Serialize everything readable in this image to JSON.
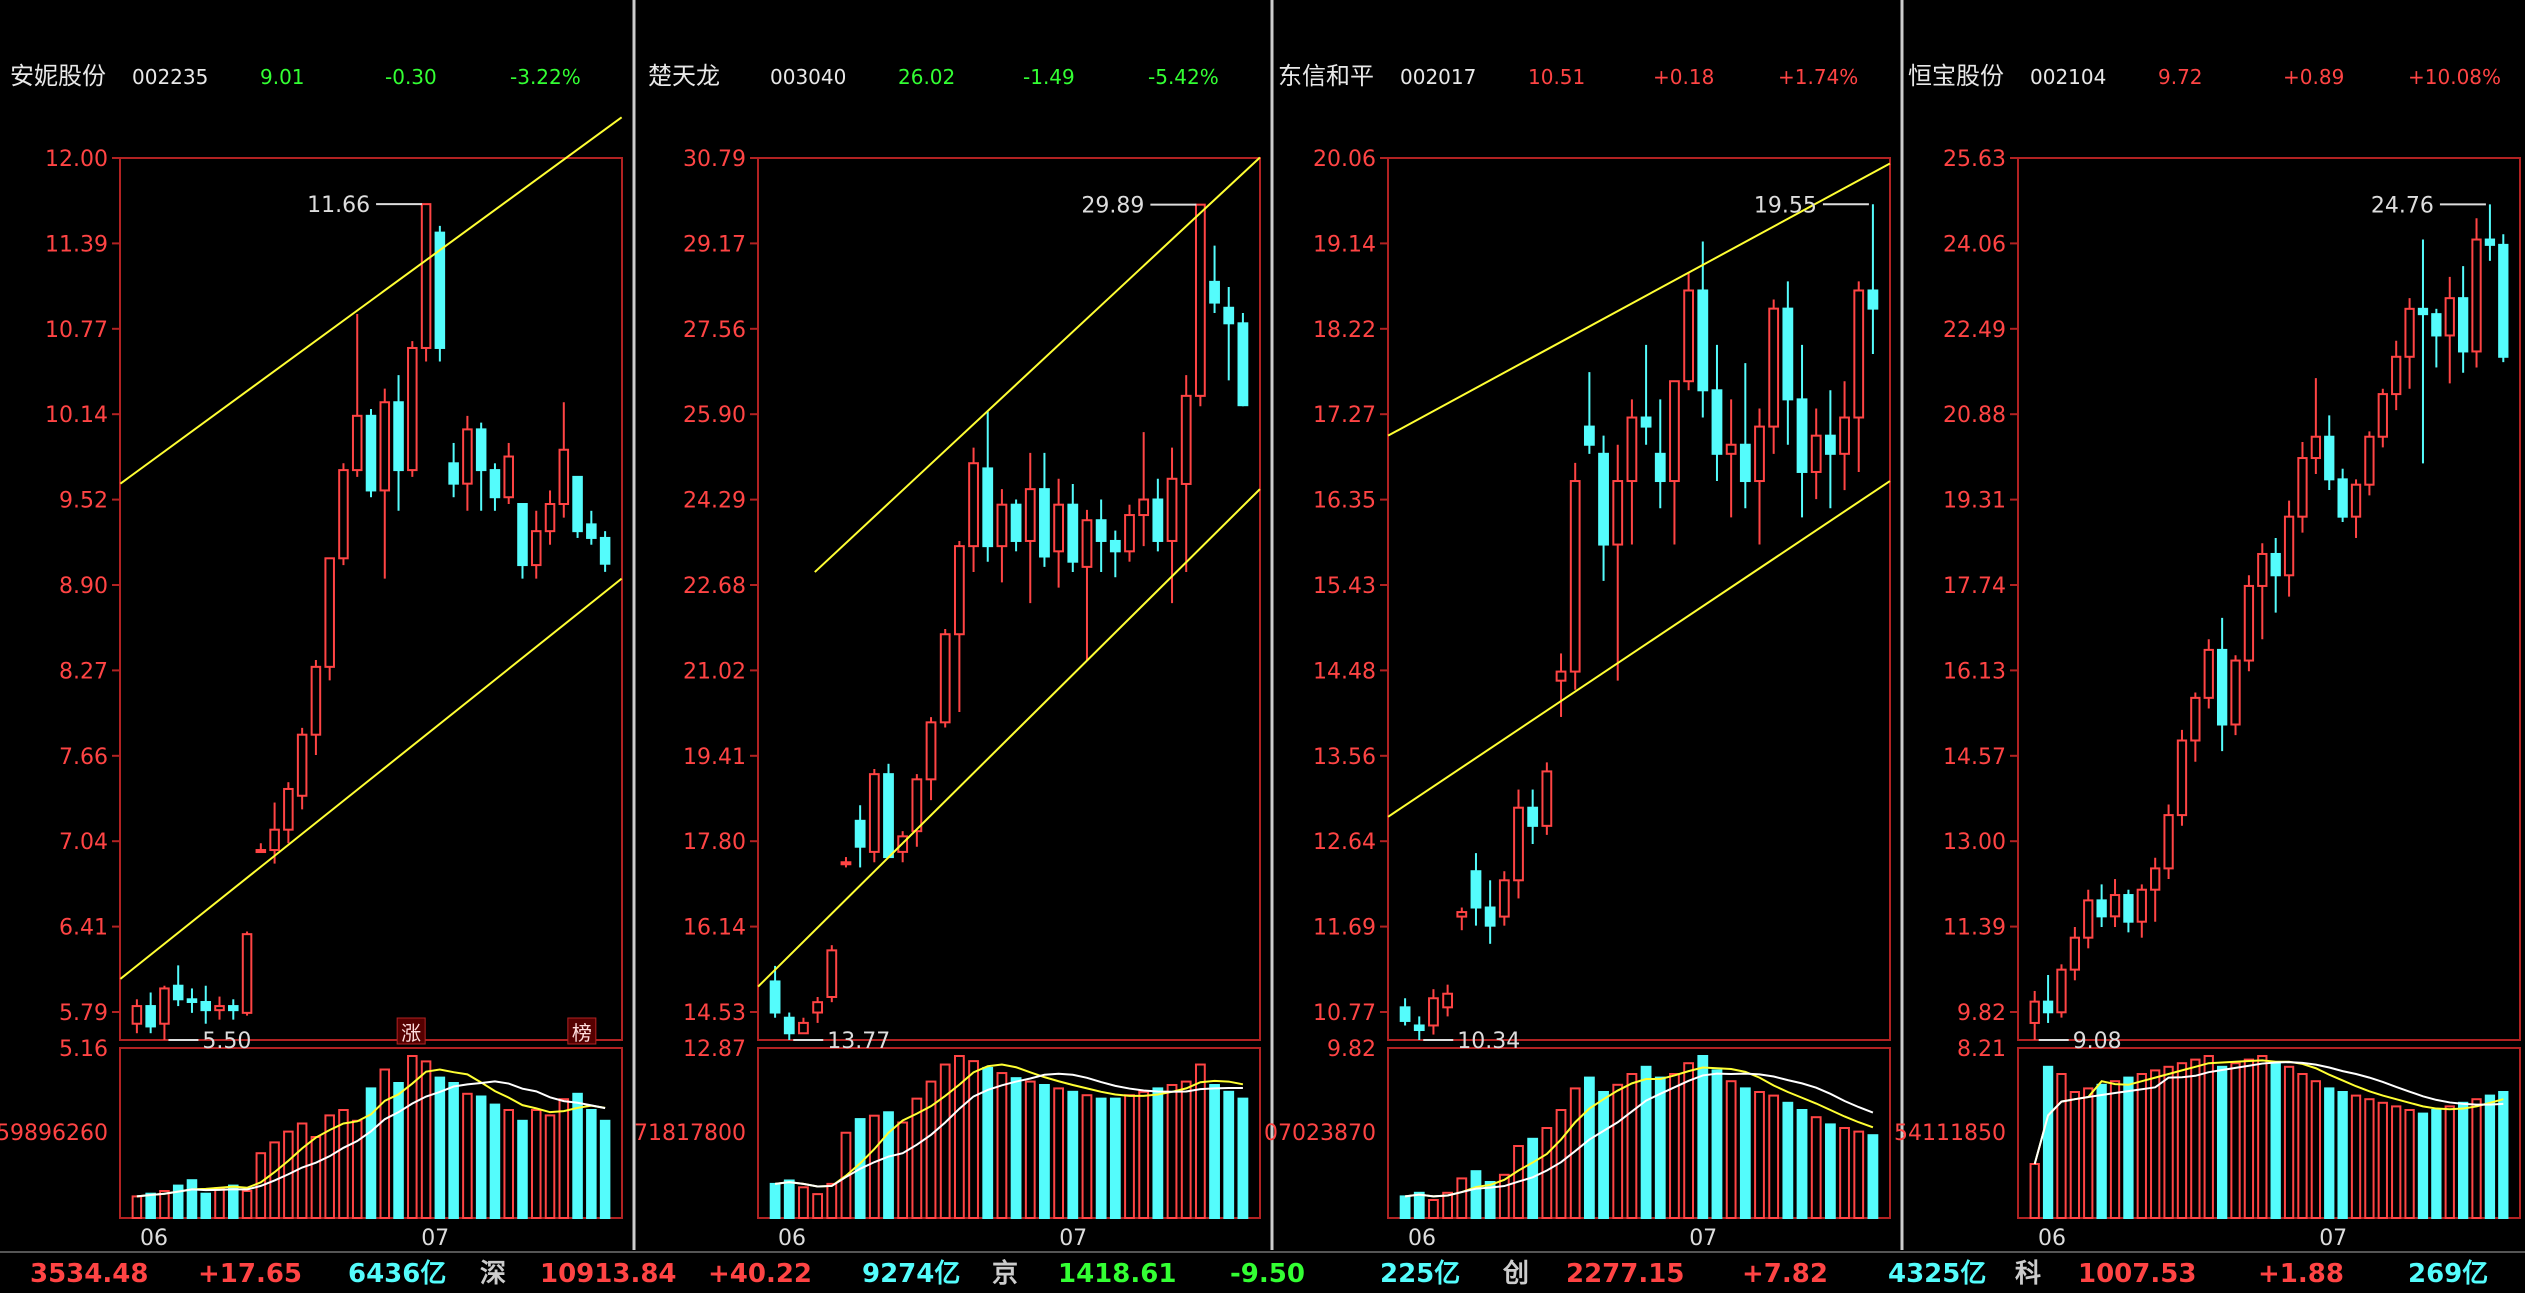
{
  "colors": {
    "up": "#ff4444",
    "down": "#54fcfc",
    "channel": "#ffff33",
    "ma_short": "#ffff33",
    "ma_long": "#ffffff",
    "frame": "#b22222",
    "gridlabel": "#ff4444",
    "neutral": "#cccccc"
  },
  "panels": [
    {
      "name": "安妮股份",
      "code": "002235",
      "price": "9.01",
      "change": "-0.30",
      "pct": "-3.22%",
      "direction": "down",
      "price_axis": [
        "12.00",
        "11.39",
        "10.77",
        "10.14",
        "9.52",
        "8.90",
        "8.27",
        "7.66",
        "7.04",
        "6.41",
        "5.79"
      ],
      "vol_top": "5.16",
      "vol_mid": "59896260",
      "x_labels": [
        "06",
        "07"
      ],
      "high_label": "11.66",
      "low_label": "5.50",
      "markers": [
        "涨",
        "榜"
      ]
    },
    {
      "name": "楚天龙",
      "code": "003040",
      "price": "26.02",
      "change": "-1.49",
      "pct": "-5.42%",
      "direction": "down",
      "price_axis": [
        "30.79",
        "29.17",
        "27.56",
        "25.90",
        "24.29",
        "22.68",
        "21.02",
        "19.41",
        "17.80",
        "16.14",
        "14.53"
      ],
      "vol_top": "12.87",
      "vol_mid": "71817800",
      "x_labels": [
        "06",
        "07"
      ],
      "high_label": "29.89",
      "low_label": "13.77",
      "markers": []
    },
    {
      "name": "东信和平",
      "code": "002017",
      "price": "10.51",
      "change": "+0.18",
      "pct": "+1.74%",
      "direction": "up",
      "price_axis": [
        "20.06",
        "19.14",
        "18.22",
        "17.27",
        "16.35",
        "15.43",
        "14.48",
        "13.56",
        "12.64",
        "11.69",
        "10.77"
      ],
      "vol_top": "9.82",
      "vol_mid": "07023870",
      "x_labels": [
        "06",
        "07"
      ],
      "high_label": "19.55",
      "low_label": "10.34",
      "markers": []
    },
    {
      "name": "恒宝股份",
      "code": "002104",
      "price": "9.72",
      "change": "+0.89",
      "pct": "+10.08%",
      "direction": "up",
      "price_axis": [
        "25.63",
        "24.06",
        "22.49",
        "20.88",
        "19.31",
        "17.74",
        "16.13",
        "14.57",
        "13.00",
        "11.39",
        "9.82"
      ],
      "vol_top": "8.21",
      "vol_mid": "54111850",
      "x_labels": [
        "06",
        "07"
      ],
      "high_label": "24.76",
      "low_label": "9.08",
      "markers": []
    }
  ],
  "status_bar": [
    {
      "text": "3534.48",
      "color": "#ff4444"
    },
    {
      "text": "+17.65",
      "color": "#ff4444"
    },
    {
      "text": "6436亿",
      "color": "#54fcfc"
    },
    {
      "text": "深",
      "color": "#cccccc"
    },
    {
      "text": "10913.84",
      "color": "#ff4444"
    },
    {
      "text": "+40.22",
      "color": "#ff4444"
    },
    {
      "text": "9274亿",
      "color": "#54fcfc"
    },
    {
      "text": "京",
      "color": "#cccccc"
    },
    {
      "text": "1418.61",
      "color": "#33ff33"
    },
    {
      "text": "-9.50",
      "color": "#33ff33"
    },
    {
      "text": "225亿",
      "color": "#54fcfc"
    },
    {
      "text": "创",
      "color": "#cccccc"
    },
    {
      "text": "2277.15",
      "color": "#ff4444"
    },
    {
      "text": "+7.82",
      "color": "#ff4444"
    },
    {
      "text": "4325亿",
      "color": "#54fcfc"
    },
    {
      "text": "科",
      "color": "#cccccc"
    },
    {
      "text": "1007.53",
      "color": "#ff4444"
    },
    {
      "text": "+1.88",
      "color": "#ff4444"
    },
    {
      "text": "269亿",
      "color": "#54fcfc"
    }
  ],
  "chart_data": [
    {
      "type": "candlestick",
      "title": "安妮股份 002235",
      "ylim": [
        5.5,
        12.0
      ],
      "x_ticks": [
        "06",
        "07"
      ],
      "y_ticks": [
        12.0,
        11.39,
        10.77,
        10.14,
        9.52,
        8.9,
        8.27,
        7.66,
        7.04,
        6.41,
        5.79
      ],
      "candles": [
        [
          5.62,
          5.8,
          5.55,
          5.75
        ],
        [
          5.75,
          5.85,
          5.55,
          5.6
        ],
        [
          5.62,
          5.9,
          5.5,
          5.88
        ],
        [
          5.9,
          6.05,
          5.75,
          5.8
        ],
        [
          5.8,
          5.88,
          5.7,
          5.78
        ],
        [
          5.78,
          5.9,
          5.62,
          5.72
        ],
        [
          5.72,
          5.82,
          5.65,
          5.75
        ],
        [
          5.75,
          5.8,
          5.65,
          5.72
        ],
        [
          5.7,
          6.3,
          5.68,
          6.28
        ],
        [
          6.9,
          6.95,
          6.88,
          6.9
        ],
        [
          6.9,
          7.25,
          6.8,
          7.05
        ],
        [
          7.05,
          7.4,
          6.95,
          7.35
        ],
        [
          7.3,
          7.8,
          7.2,
          7.75
        ],
        [
          7.75,
          8.3,
          7.6,
          8.25
        ],
        [
          8.25,
          9.05,
          8.15,
          9.05
        ],
        [
          9.05,
          9.75,
          9.0,
          9.7
        ],
        [
          9.7,
          10.85,
          9.65,
          10.1
        ],
        [
          10.1,
          10.15,
          9.5,
          9.55
        ],
        [
          9.55,
          10.3,
          8.9,
          10.2
        ],
        [
          10.2,
          10.4,
          9.4,
          9.7
        ],
        [
          9.7,
          10.65,
          9.65,
          10.6
        ],
        [
          10.6,
          11.66,
          10.5,
          11.66
        ],
        [
          11.45,
          11.5,
          10.5,
          10.6
        ],
        [
          9.75,
          9.9,
          9.5,
          9.6
        ],
        [
          9.6,
          10.1,
          9.4,
          10.0
        ],
        [
          10.0,
          10.05,
          9.4,
          9.7
        ],
        [
          9.7,
          9.75,
          9.4,
          9.5
        ],
        [
          9.5,
          9.9,
          9.45,
          9.8
        ],
        [
          9.45,
          9.45,
          8.9,
          9.0
        ],
        [
          9.0,
          9.4,
          8.9,
          9.25
        ],
        [
          9.25,
          9.55,
          9.15,
          9.45
        ],
        [
          9.45,
          10.2,
          9.35,
          9.85
        ],
        [
          9.65,
          9.65,
          9.2,
          9.25
        ],
        [
          9.3,
          9.4,
          9.15,
          9.2
        ],
        [
          9.2,
          9.25,
          8.95,
          9.01
        ]
      ],
      "volume": [
        8,
        9,
        10,
        12,
        14,
        9,
        11,
        12,
        10,
        24,
        28,
        32,
        35,
        30,
        38,
        40,
        36,
        48,
        55,
        50,
        60,
        58,
        52,
        50,
        46,
        45,
        42,
        40,
        36,
        40,
        38,
        44,
        46,
        40,
        36
      ],
      "channel": {
        "upper": [
          [
            0,
            9.6
          ],
          [
            34,
            12.3
          ]
        ],
        "lower": [
          [
            0,
            5.95
          ],
          [
            34,
            8.9
          ]
        ]
      },
      "high": 11.66,
      "low": 5.5
    },
    {
      "type": "candlestick",
      "title": "楚天龙 003040",
      "ylim": [
        13.77,
        30.79
      ],
      "x_ticks": [
        "06",
        "07"
      ],
      "y_ticks": [
        30.79,
        29.17,
        27.56,
        25.9,
        24.29,
        22.68,
        21.02,
        19.41,
        17.8,
        16.14,
        14.53
      ],
      "candles": [
        [
          14.9,
          15.2,
          14.2,
          14.3
        ],
        [
          14.2,
          14.3,
          13.77,
          13.9
        ],
        [
          13.9,
          14.2,
          13.9,
          14.1
        ],
        [
          14.3,
          14.6,
          14.1,
          14.5
        ],
        [
          14.6,
          15.6,
          14.5,
          15.5
        ],
        [
          17.2,
          17.3,
          17.1,
          17.2
        ],
        [
          18.0,
          18.3,
          17.1,
          17.5
        ],
        [
          17.4,
          19.0,
          17.2,
          18.9
        ],
        [
          18.9,
          19.1,
          17.3,
          17.3
        ],
        [
          17.4,
          17.8,
          17.2,
          17.7
        ],
        [
          17.8,
          18.9,
          17.5,
          18.8
        ],
        [
          18.8,
          20.0,
          18.4,
          19.9
        ],
        [
          19.9,
          21.7,
          19.8,
          21.6
        ],
        [
          21.6,
          23.4,
          20.1,
          23.3
        ],
        [
          23.3,
          25.2,
          22.8,
          24.9
        ],
        [
          24.8,
          25.9,
          23.0,
          23.3
        ],
        [
          23.3,
          24.4,
          22.6,
          24.1
        ],
        [
          24.1,
          24.2,
          23.2,
          23.4
        ],
        [
          23.4,
          25.1,
          22.2,
          24.4
        ],
        [
          24.4,
          25.1,
          22.9,
          23.1
        ],
        [
          23.2,
          24.6,
          22.5,
          24.1
        ],
        [
          24.1,
          24.5,
          22.8,
          23.0
        ],
        [
          22.9,
          24.0,
          21.1,
          23.8
        ],
        [
          23.8,
          24.2,
          22.8,
          23.4
        ],
        [
          23.4,
          23.6,
          22.7,
          23.2
        ],
        [
          23.2,
          24.1,
          23.0,
          23.9
        ],
        [
          23.9,
          25.5,
          23.3,
          24.2
        ],
        [
          24.2,
          24.6,
          23.2,
          23.4
        ],
        [
          23.4,
          25.2,
          22.2,
          24.6
        ],
        [
          24.5,
          26.6,
          22.8,
          26.2
        ],
        [
          26.2,
          29.89,
          26.0,
          29.89
        ],
        [
          28.4,
          29.1,
          27.8,
          28.0
        ],
        [
          27.9,
          28.3,
          26.5,
          27.6
        ],
        [
          27.6,
          27.8,
          26.0,
          26.02
        ]
      ],
      "volume": [
        20,
        22,
        18,
        14,
        20,
        50,
        58,
        60,
        62,
        56,
        70,
        80,
        90,
        95,
        92,
        88,
        85,
        82,
        80,
        78,
        76,
        74,
        72,
        70,
        70,
        72,
        74,
        76,
        78,
        80,
        90,
        78,
        74,
        70
      ],
      "channel": {
        "upper": [
          [
            4,
            22.8
          ],
          [
            33,
            30.8
          ]
        ],
        "lower": [
          [
            0,
            14.8
          ],
          [
            33,
            24.4
          ]
        ]
      },
      "high": 29.89,
      "low": 13.77
    },
    {
      "type": "candlestick",
      "title": "东信和平 002017",
      "ylim": [
        10.34,
        20.06
      ],
      "x_ticks": [
        "06",
        "07"
      ],
      "y_ticks": [
        20.06,
        19.14,
        18.22,
        17.27,
        16.35,
        15.43,
        14.48,
        13.56,
        12.64,
        11.69,
        10.77
      ],
      "candles": [
        [
          10.7,
          10.8,
          10.5,
          10.55
        ],
        [
          10.5,
          10.6,
          10.34,
          10.45
        ],
        [
          10.5,
          10.9,
          10.4,
          10.8
        ],
        [
          10.7,
          10.95,
          10.6,
          10.85
        ],
        [
          11.7,
          11.8,
          11.55,
          11.75
        ],
        [
          12.2,
          12.4,
          11.6,
          11.8
        ],
        [
          11.8,
          12.1,
          11.4,
          11.6
        ],
        [
          11.7,
          12.2,
          11.6,
          12.1
        ],
        [
          12.1,
          13.1,
          11.9,
          12.9
        ],
        [
          12.9,
          13.1,
          12.5,
          12.7
        ],
        [
          12.7,
          13.4,
          12.6,
          13.3
        ],
        [
          14.3,
          14.6,
          13.9,
          14.4
        ],
        [
          14.4,
          16.7,
          14.2,
          16.5
        ],
        [
          17.1,
          17.7,
          16.8,
          16.9
        ],
        [
          16.8,
          17.0,
          15.4,
          15.8
        ],
        [
          15.8,
          16.9,
          14.3,
          16.5
        ],
        [
          16.5,
          17.4,
          15.8,
          17.2
        ],
        [
          17.2,
          18.0,
          16.9,
          17.1
        ],
        [
          16.8,
          17.4,
          16.2,
          16.5
        ],
        [
          16.5,
          17.6,
          15.8,
          17.6
        ],
        [
          17.6,
          18.8,
          17.5,
          18.6
        ],
        [
          18.6,
          19.14,
          17.2,
          17.5
        ],
        [
          17.5,
          18.0,
          16.5,
          16.8
        ],
        [
          16.8,
          17.4,
          16.1,
          16.9
        ],
        [
          16.9,
          17.8,
          16.2,
          16.5
        ],
        [
          16.5,
          17.3,
          15.8,
          17.1
        ],
        [
          17.1,
          18.5,
          16.8,
          18.4
        ],
        [
          18.4,
          18.7,
          16.9,
          17.4
        ],
        [
          17.4,
          18.0,
          16.1,
          16.6
        ],
        [
          16.6,
          17.3,
          16.3,
          17.0
        ],
        [
          17.0,
          17.5,
          16.2,
          16.8
        ],
        [
          16.8,
          17.6,
          16.4,
          17.2
        ],
        [
          17.2,
          18.7,
          16.6,
          18.6
        ],
        [
          18.6,
          19.55,
          17.9,
          18.4
        ]
      ],
      "volume": [
        12,
        14,
        10,
        14,
        22,
        26,
        20,
        24,
        40,
        44,
        50,
        60,
        72,
        78,
        70,
        74,
        80,
        84,
        78,
        80,
        86,
        90,
        82,
        76,
        72,
        70,
        68,
        64,
        60,
        56,
        52,
        50,
        48,
        46
      ],
      "channel": {
        "upper": [
          [
            0,
            17.0
          ],
          [
            33,
            20.0
          ]
        ],
        "lower": [
          [
            0,
            12.8
          ],
          [
            33,
            16.5
          ]
        ]
      },
      "high": 19.55,
      "low": 10.34
    },
    {
      "type": "candlestick",
      "title": "恒宝股份 002104",
      "ylim": [
        9.08,
        25.63
      ],
      "x_ticks": [
        "06",
        "07"
      ],
      "y_ticks": [
        25.63,
        24.06,
        22.49,
        20.88,
        19.31,
        17.74,
        16.13,
        14.57,
        13.0,
        11.39,
        9.82
      ],
      "candles": [
        [
          9.4,
          10.0,
          9.08,
          9.8
        ],
        [
          9.8,
          10.3,
          9.4,
          9.6
        ],
        [
          9.6,
          10.5,
          9.5,
          10.4
        ],
        [
          10.4,
          11.2,
          10.2,
          11.0
        ],
        [
          11.0,
          11.9,
          10.8,
          11.7
        ],
        [
          11.7,
          12.0,
          11.2,
          11.4
        ],
        [
          11.4,
          12.1,
          11.2,
          11.8
        ],
        [
          11.8,
          11.9,
          11.1,
          11.3
        ],
        [
          11.3,
          12.0,
          11.0,
          11.9
        ],
        [
          11.9,
          12.5,
          11.3,
          12.3
        ],
        [
          12.3,
          13.5,
          12.1,
          13.3
        ],
        [
          13.3,
          14.9,
          13.1,
          14.7
        ],
        [
          14.7,
          15.6,
          14.3,
          15.5
        ],
        [
          15.5,
          16.6,
          15.3,
          16.4
        ],
        [
          16.4,
          17.0,
          14.5,
          15.0
        ],
        [
          15.0,
          16.3,
          14.8,
          16.2
        ],
        [
          16.2,
          17.8,
          16.0,
          17.6
        ],
        [
          17.6,
          18.4,
          16.6,
          18.2
        ],
        [
          18.2,
          18.5,
          17.1,
          17.8
        ],
        [
          17.8,
          19.2,
          17.4,
          18.9
        ],
        [
          18.9,
          20.3,
          18.6,
          20.0
        ],
        [
          20.0,
          21.5,
          19.7,
          20.4
        ],
        [
          20.4,
          20.8,
          19.4,
          19.6
        ],
        [
          19.6,
          19.8,
          18.8,
          18.9
        ],
        [
          18.9,
          19.6,
          18.5,
          19.5
        ],
        [
          19.5,
          20.5,
          19.3,
          20.4
        ],
        [
          20.4,
          21.3,
          20.2,
          21.2
        ],
        [
          21.2,
          22.2,
          20.9,
          21.9
        ],
        [
          21.9,
          23.0,
          21.3,
          22.8
        ],
        [
          22.8,
          24.1,
          19.9,
          22.7
        ],
        [
          22.7,
          22.8,
          21.7,
          22.3
        ],
        [
          22.3,
          23.4,
          21.4,
          23.0
        ],
        [
          23.0,
          23.6,
          21.6,
          22.0
        ],
        [
          22.0,
          24.5,
          21.7,
          24.1
        ],
        [
          24.1,
          24.76,
          23.7,
          24.0
        ],
        [
          24.0,
          24.2,
          21.8,
          21.9
        ]
      ],
      "volume": [
        30,
        84,
        80,
        70,
        72,
        74,
        76,
        78,
        80,
        82,
        84,
        86,
        88,
        90,
        84,
        86,
        88,
        90,
        86,
        84,
        80,
        76,
        72,
        70,
        68,
        66,
        64,
        62,
        60,
        58,
        60,
        62,
        64,
        66,
        68,
        70
      ],
      "channel": null,
      "high": 24.76,
      "low": 9.08
    }
  ]
}
